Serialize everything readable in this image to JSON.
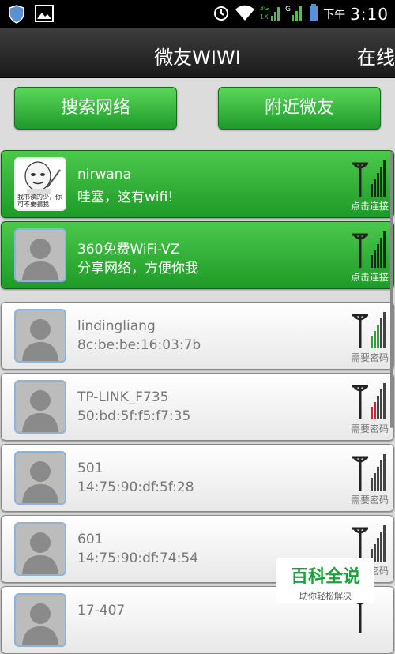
{
  "status_bar": {
    "left_icons": [
      "shield-icon",
      "image-icon"
    ],
    "right_icons": [
      "alarm-icon",
      "wifi-icon",
      "3g-signal-icon",
      "signal-icon",
      "battery-icon"
    ],
    "ampm": "下午",
    "time": "3:10"
  },
  "header": {
    "title": "微友WIWI",
    "right": "在线"
  },
  "buttons": {
    "search": "搜索网络",
    "nearby": "附近微友"
  },
  "networks": [
    {
      "name": "nirwana",
      "sub": "哇塞，这有wifi!",
      "status": "点击连接",
      "style": "green",
      "avatar": "meme",
      "meme_text": "我书读的少，你可不要骗我"
    },
    {
      "name": "360免费WiFi-VZ",
      "sub": "分享网络，方便你我",
      "status": "点击连接",
      "style": "green",
      "avatar": "default"
    },
    {
      "name": "lindingliang",
      "sub": "8c:be:be:16:03:7b",
      "status": "需要密码",
      "style": "white",
      "avatar": "default"
    },
    {
      "name": "TP-LINK_F735",
      "sub": "50:bd:5f:f5:f7:35",
      "status": "需要密码",
      "style": "white",
      "avatar": "default"
    },
    {
      "name": "501",
      "sub": "14:75:90:df:5f:28",
      "status": "需要密码",
      "style": "white",
      "avatar": "default"
    },
    {
      "name": "601",
      "sub": "14:75:90:df:74:54",
      "status": "需要密码",
      "style": "white",
      "avatar": "default"
    },
    {
      "name": "17-407",
      "sub": "",
      "status": "",
      "style": "white",
      "avatar": "default"
    }
  ],
  "watermark": {
    "title": "百科全说",
    "subtitle": "助你轻松解决"
  },
  "colors": {
    "accent_green": "#1e9a28",
    "signal_red": "#d8222a"
  }
}
